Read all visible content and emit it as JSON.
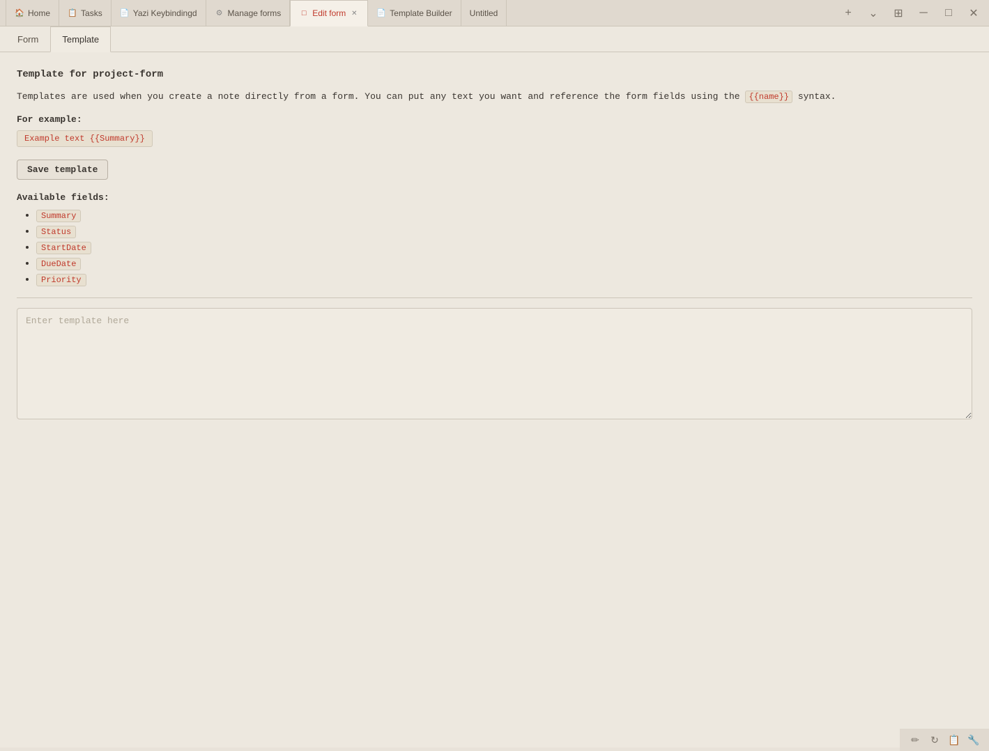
{
  "titlebar": {
    "tabs": [
      {
        "id": "home",
        "label": "Home",
        "icon": "🏠",
        "active": false,
        "closable": false,
        "separator_after": true
      },
      {
        "id": "tasks",
        "label": "Tasks",
        "icon": "📋",
        "active": false,
        "closable": false,
        "separator_after": true
      },
      {
        "id": "yazi",
        "label": "Yazi Keybindingd",
        "icon": "📄",
        "active": false,
        "closable": false,
        "separator_after": true
      },
      {
        "id": "manage-forms",
        "label": "Manage forms",
        "icon": "⚙",
        "active": false,
        "closable": false,
        "separator_after": true
      },
      {
        "id": "edit-form",
        "label": "Edit form",
        "icon": "□",
        "active": true,
        "closable": true,
        "separator_after": true
      },
      {
        "id": "template-builder",
        "label": "Template Builder",
        "icon": "📄",
        "active": false,
        "closable": false,
        "separator_after": true
      },
      {
        "id": "untitled",
        "label": "Untitled",
        "icon": "",
        "active": false,
        "closable": false,
        "separator_after": false
      }
    ],
    "add_label": "+",
    "chevron_label": "⌄"
  },
  "content": {
    "tabs": [
      {
        "id": "form",
        "label": "Form",
        "active": false
      },
      {
        "id": "template",
        "label": "Template",
        "active": true
      }
    ],
    "section_title": "Template for project-form",
    "description": "Templates are used when you create a note directly from a form. You can put any text you want and reference the form fields using the",
    "syntax_code": "{{name}}",
    "description_suffix": "syntax.",
    "example_label": "For example:",
    "example_code": "Example text {{Summary}}",
    "save_button_label": "Save template",
    "available_fields_label": "Available fields:",
    "fields": [
      "Summary",
      "Status",
      "StartDate",
      "DueDate",
      "Priority"
    ],
    "textarea_placeholder": "Enter template here"
  },
  "statusbar": {
    "icons": [
      "✏",
      "↻",
      "📋",
      "🔧"
    ]
  }
}
